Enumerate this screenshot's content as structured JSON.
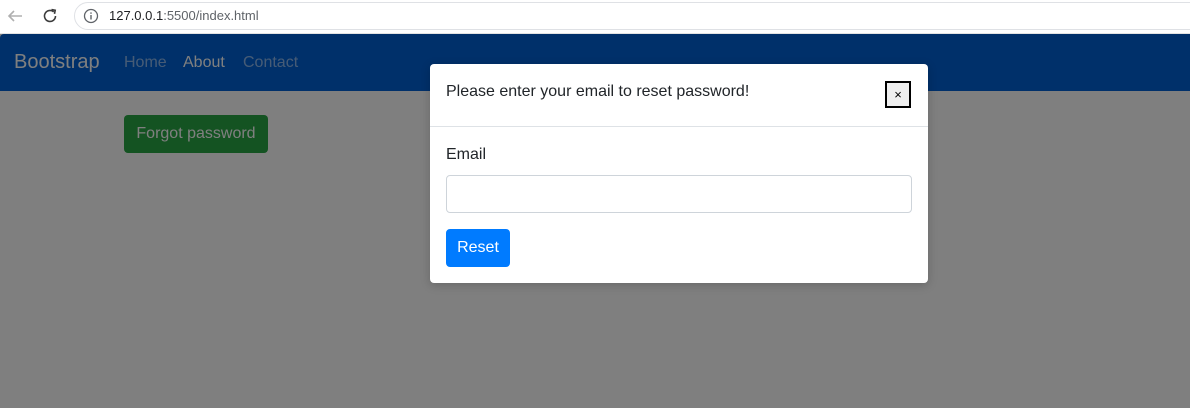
{
  "browser": {
    "url_host": "127.0.0.1",
    "url_rest": ":5500/index.html",
    "back_icon": "arrow-left-icon",
    "reload_icon": "reload-icon",
    "info_icon": "info-icon"
  },
  "navbar": {
    "brand": "Bootstrap",
    "links": [
      {
        "label": "Home",
        "active": false
      },
      {
        "label": "About",
        "active": true
      },
      {
        "label": "Contact",
        "active": false
      }
    ],
    "color": "#0061d4"
  },
  "main": {
    "forgot_label": "Forgot password",
    "forgot_color": "#28a745"
  },
  "modal": {
    "title": "Please enter your email to reset password!",
    "close_label": "×",
    "email_label": "Email",
    "email_value": "",
    "email_placeholder": "",
    "reset_label": "Reset",
    "reset_color": "#007bff"
  }
}
